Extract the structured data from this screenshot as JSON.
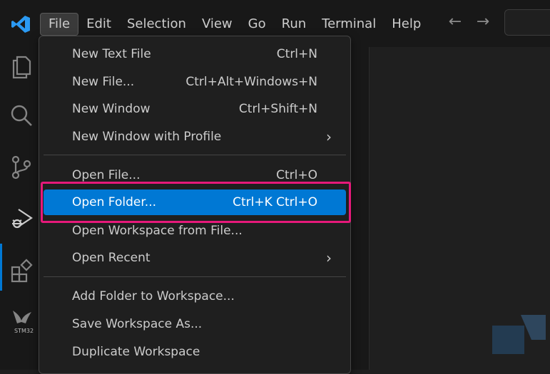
{
  "menubar": {
    "items": [
      {
        "label": "File"
      },
      {
        "label": "Edit"
      },
      {
        "label": "Selection"
      },
      {
        "label": "View"
      },
      {
        "label": "Go"
      },
      {
        "label": "Run"
      },
      {
        "label": "Terminal"
      },
      {
        "label": "Help"
      }
    ],
    "back_icon": "←",
    "forward_icon": "→"
  },
  "activitybar": {
    "icons": [
      "explorer-icon",
      "search-icon",
      "source-control-icon",
      "run-debug-icon",
      "extensions-icon",
      "stm32-icon"
    ],
    "stm_label": "STM32"
  },
  "file_menu": {
    "items": [
      {
        "label": "New Text File",
        "shortcut": "Ctrl+N"
      },
      {
        "label": "New File...",
        "shortcut": "Ctrl+Alt+Windows+N"
      },
      {
        "label": "New Window",
        "shortcut": "Ctrl+Shift+N"
      },
      {
        "label": "New Window with Profile",
        "shortcut": "",
        "submenu": "›"
      },
      {
        "label": "Open File...",
        "shortcut": "Ctrl+O"
      },
      {
        "label": "Open Folder...",
        "shortcut": "Ctrl+K Ctrl+O",
        "selected": true
      },
      {
        "label": "Open Workspace from File...",
        "shortcut": ""
      },
      {
        "label": "Open Recent",
        "shortcut": "",
        "submenu": "›"
      },
      {
        "label": "Add Folder to Workspace...",
        "shortcut": ""
      },
      {
        "label": "Save Workspace As...",
        "shortcut": ""
      },
      {
        "label": "Duplicate Workspace",
        "shortcut": ""
      }
    ]
  },
  "colors": {
    "accent": "#0078d4",
    "highlight_box": "#e6197a",
    "logo_blue": "#2b9af3"
  }
}
